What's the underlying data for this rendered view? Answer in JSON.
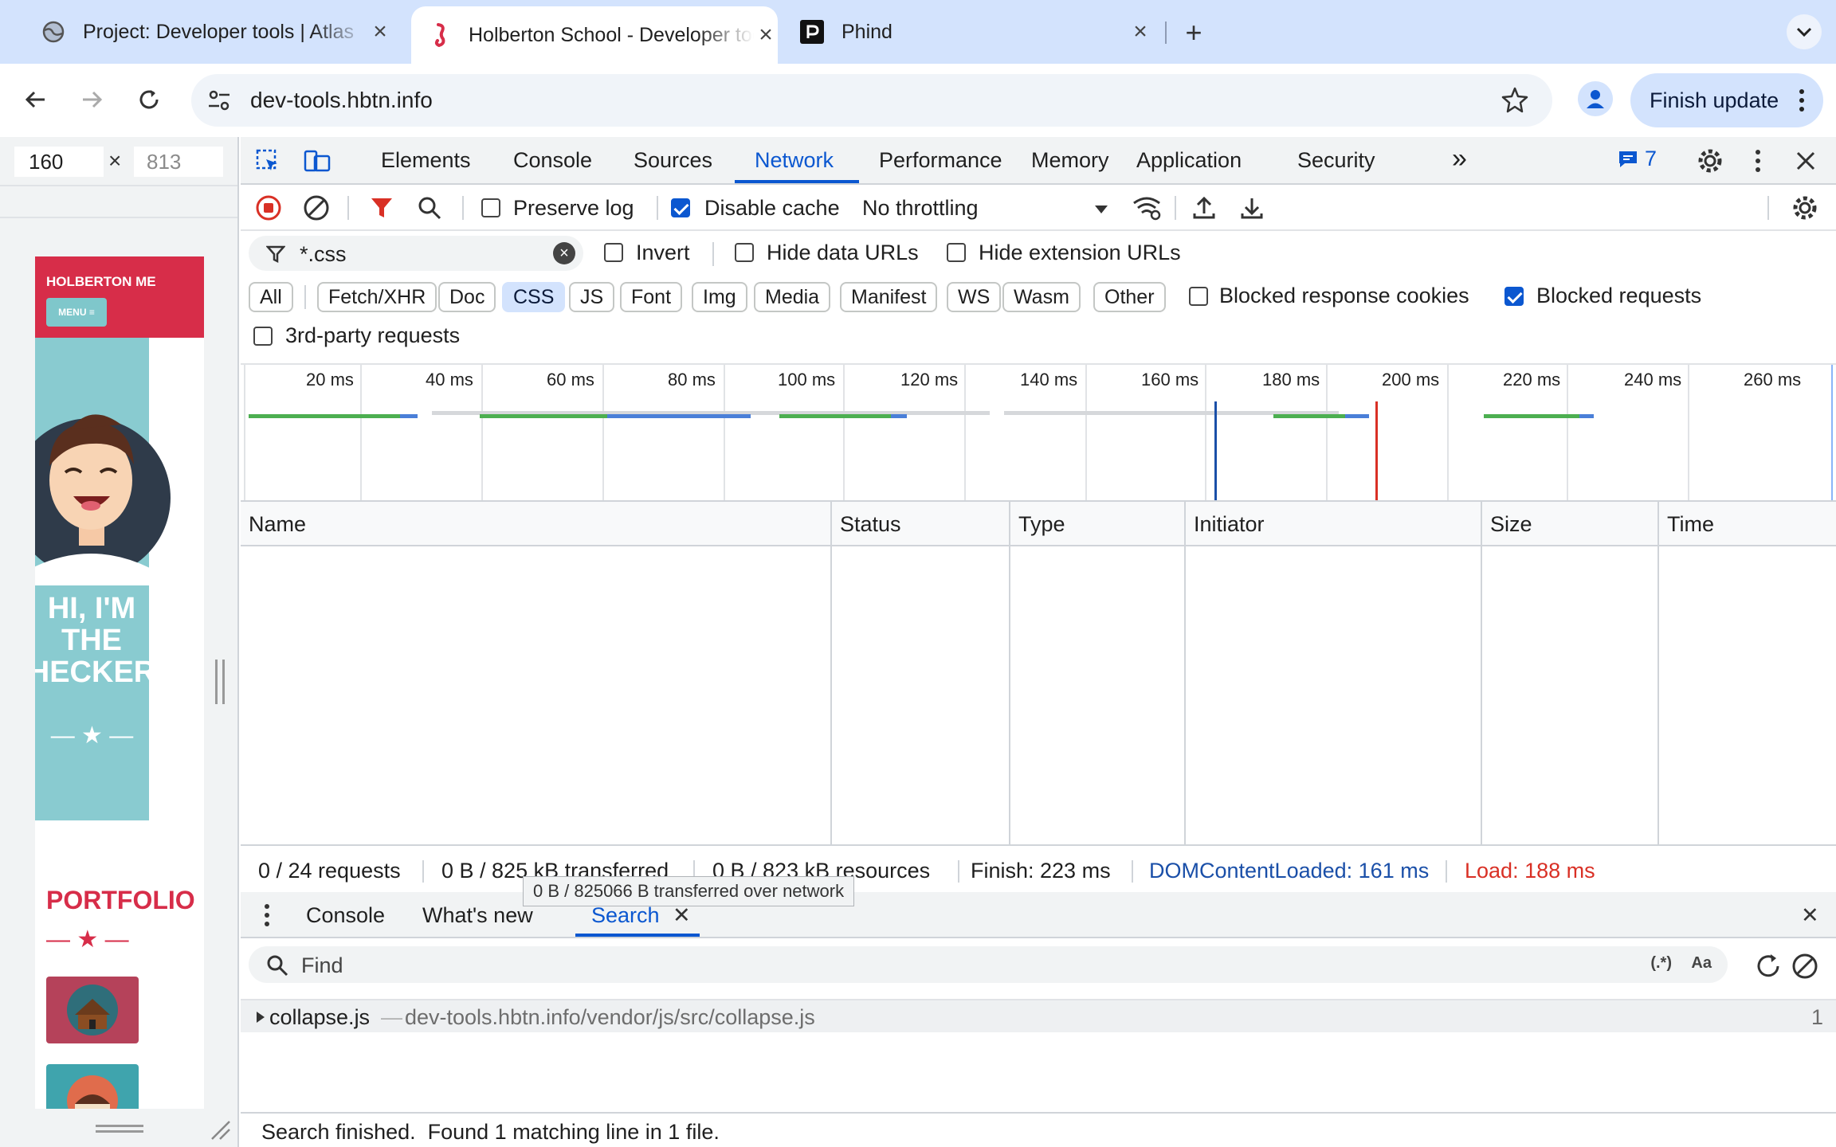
{
  "browser": {
    "tabs": [
      {
        "title": "Project: Developer tools | Atlas",
        "favicon": "globe-icon"
      },
      {
        "title": "Holberton School - Developer tools",
        "favicon": "seahorse-icon"
      },
      {
        "title": "Phind",
        "favicon": "phind-icon"
      }
    ],
    "url": "dev-tools.hbtn.info",
    "update_label": "Finish update"
  },
  "device": {
    "width": "160",
    "x": "×",
    "height": "813",
    "site": {
      "brand": "HOLBERTON ME",
      "menu": "MENU ≡",
      "hero_title": "HI, I'M THE HECKER",
      "hero_stars": "— ★ —",
      "portfolio": "PORTFOLIO",
      "portfolio_stars": "— ★ —"
    }
  },
  "devtools": {
    "tabs": [
      "Elements",
      "Console",
      "Sources",
      "Network",
      "Performance",
      "Memory",
      "Application",
      "Security"
    ],
    "active_tab": "Network",
    "more": "»",
    "issues_count": "7",
    "toolbar": {
      "preserve_log": "Preserve log",
      "preserve_log_checked": false,
      "disable_cache": "Disable cache",
      "disable_cache_checked": true,
      "throttling": "No throttling"
    },
    "filter": {
      "value": "*.css",
      "invert": "Invert",
      "hide_data_urls": "Hide data URLs",
      "hide_extension_urls": "Hide extension URLs"
    },
    "type_filters": [
      "All",
      "Fetch/XHR",
      "Doc",
      "CSS",
      "JS",
      "Font",
      "Img",
      "Media",
      "Manifest",
      "WS",
      "Wasm",
      "Other"
    ],
    "active_type": "CSS",
    "blocked_response_cookies": "Blocked response cookies",
    "blocked_response_cookies_checked": false,
    "blocked_requests": "Blocked requests",
    "blocked_requests_checked": true,
    "third_party": "3rd-party requests",
    "overview_ticks": [
      "20 ms",
      "40 ms",
      "60 ms",
      "80 ms",
      "100 ms",
      "120 ms",
      "140 ms",
      "160 ms",
      "180 ms",
      "200 ms",
      "220 ms",
      "240 ms",
      "260 ms"
    ],
    "columns": [
      "Name",
      "Status",
      "Type",
      "Initiator",
      "Size",
      "Time"
    ],
    "summary": {
      "requests": "0 / 24 requests",
      "transferred": "0 B / 825 kB transferred",
      "resources": "0 B / 823 kB resources",
      "finish": "Finish: 223 ms",
      "dcl": "DOMContentLoaded: 161 ms",
      "load": "Load: 188 ms"
    },
    "tooltip": "0 B / 825066 B transferred over network",
    "drawer": {
      "tabs": [
        "Console",
        "What's new",
        "Search"
      ],
      "active": "Search",
      "search_placeholder": "Find",
      "regex": "(.*)",
      "case": "Aa",
      "result_file": "collapse.js",
      "result_sep": "—",
      "result_path": "dev-tools.hbtn.info/vendor/js/src/collapse.js",
      "result_count": "1",
      "status": "Search finished.  Found 1 matching line in 1 file."
    }
  },
  "colors": {
    "accent": "#0b57d0",
    "dcl": "#1a4fa8",
    "load": "#d93025",
    "brand_red": "#d72d49",
    "brand_teal": "#89cbd0"
  }
}
